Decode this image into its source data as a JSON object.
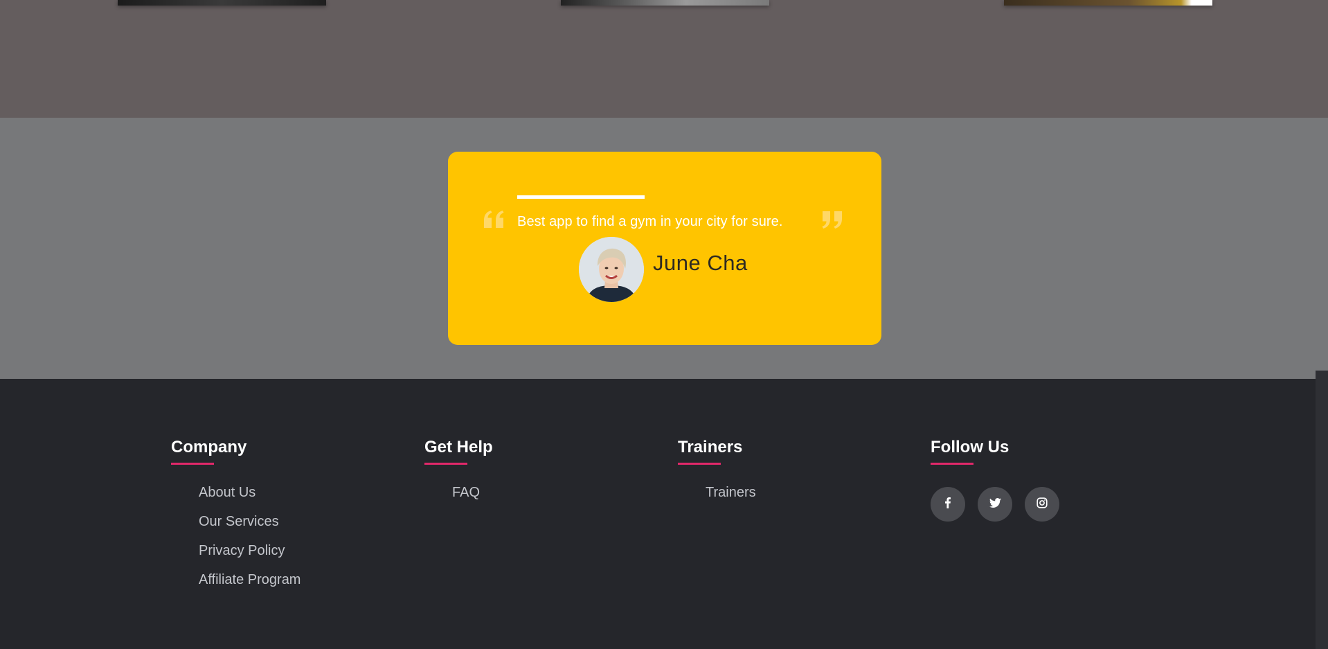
{
  "testimonial": {
    "quote": "Best app to find a gym in your city for sure.",
    "author": "June Cha"
  },
  "footer": {
    "columns": [
      {
        "heading": "Company",
        "links": [
          "About Us",
          "Our Services",
          "Privacy Policy",
          "Affiliate Program"
        ]
      },
      {
        "heading": "Get Help",
        "links": [
          "FAQ"
        ]
      },
      {
        "heading": "Trainers",
        "links": [
          "Trainers"
        ]
      },
      {
        "heading": "Follow Us",
        "social": [
          "facebook-icon",
          "twitter-icon",
          "instagram-icon"
        ]
      }
    ]
  },
  "colors": {
    "top_band": "#645d5e",
    "testimonial_band": "#77787a",
    "card": "#ffc400",
    "footer": "#25262b",
    "accent": "#e2286a",
    "social_button": "#4a4b50"
  }
}
